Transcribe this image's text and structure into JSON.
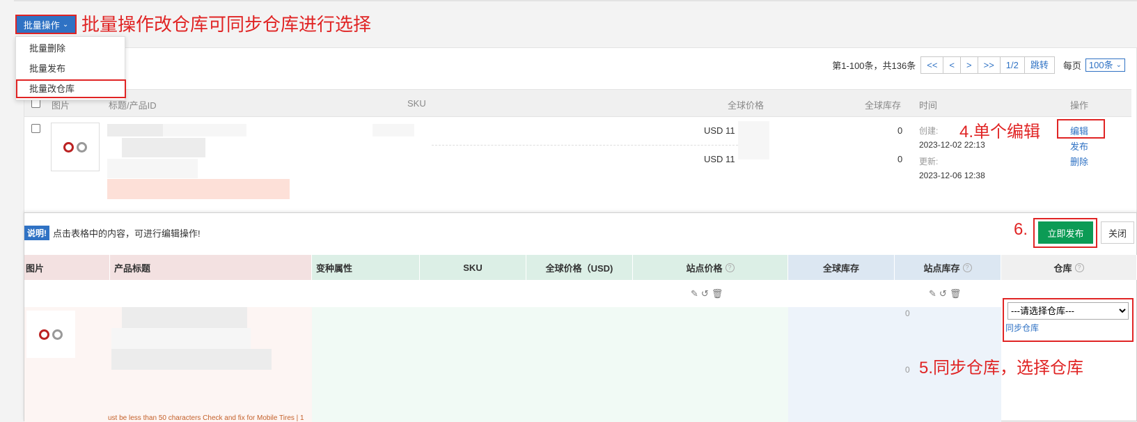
{
  "toolbar": {
    "batch_label": "批量操作",
    "annotation_batch": "批量操作改仓库可同步仓库进行选择"
  },
  "batch_menu": {
    "items": [
      "批量删除",
      "批量发布",
      "批量改仓库"
    ]
  },
  "pagination": {
    "summary": "第1-100条，共136条",
    "first": "<<",
    "prev": "<",
    "next": ">",
    "last": ">>",
    "page": "1/2",
    "jump": "跳转",
    "per_page_label": "每页",
    "per_page_value": "100条"
  },
  "list_table": {
    "headers": [
      "图片",
      "标题/产品ID",
      "SKU",
      "全球价格",
      "全球库存",
      "时间",
      "操作"
    ],
    "row": {
      "prices": [
        "USD  11",
        "USD  11"
      ],
      "stocks": [
        "0",
        "0"
      ],
      "created_label": "创建:",
      "created_time": "2023-12-02 22:13",
      "updated_label": "更新:",
      "updated_time": "2023-12-06 12:38",
      "actions": [
        "编辑",
        "发布",
        "删除"
      ]
    },
    "annotation_edit": "4.单个编辑"
  },
  "editor": {
    "note_badge": "说明!",
    "note_text": "点击表格中的内容，可进行编辑操作!",
    "annotation_publish": "6.",
    "publish_label": "立即发布",
    "close_label": "关闭",
    "headers": [
      "图片",
      "产品标题",
      "变种属性",
      "SKU",
      "全球价格（USD)",
      "站点价格",
      "全球库存",
      "站点库存",
      "仓库"
    ],
    "stock_values": [
      "0",
      "0"
    ],
    "warehouse_placeholder": "---请选择仓库---",
    "sync_warehouse": "同步仓库",
    "annotation_warehouse": "5.同步仓库，选择仓库",
    "bottom_fragment": "ust be less than 50 characters Check and fix for Mobile Tires | 1"
  },
  "colors": {
    "accent": "#2f72c4",
    "annotation": "#e02424",
    "publish": "#0c9b55"
  }
}
